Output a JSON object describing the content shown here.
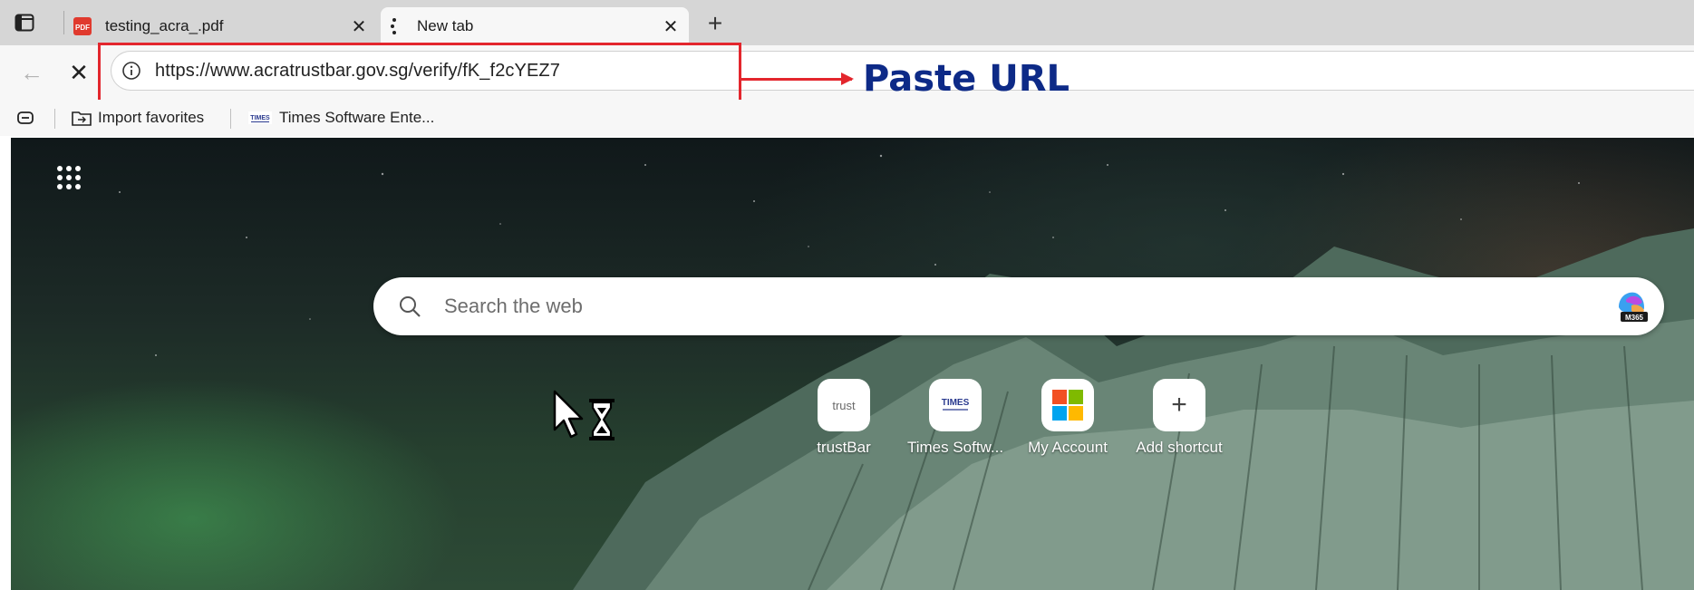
{
  "tabs": [
    {
      "title": "testing_acra_.pdf",
      "favicon": "pdf-icon",
      "active": false,
      "favicon_text": "PDF"
    },
    {
      "title": "New tab",
      "favicon": "loading-icon",
      "active": true
    }
  ],
  "address_bar": {
    "url": "https://www.acratrustbar.gov.sg/verify/fK_f2cYEZ7"
  },
  "annotation": {
    "label": "Paste URL",
    "color": "#e3262d",
    "label_color": "#0d2a87"
  },
  "bookmarks": [
    {
      "label": "Import favorites",
      "icon": "import-favorites-icon"
    },
    {
      "label": "Times Software Ente...",
      "icon": "times-software-icon",
      "icon_text": "TIMES"
    }
  ],
  "search": {
    "placeholder": "Search the web",
    "m365_badge": "M365"
  },
  "shortcuts": [
    {
      "label": "trustBar",
      "icon": "trustbar-icon",
      "tile_text": "trust"
    },
    {
      "label": "Times Softw...",
      "icon": "times-software-icon",
      "tile_text": "TIMES"
    },
    {
      "label": "My Account",
      "icon": "microsoft-logo-icon"
    },
    {
      "label": "Add shortcut",
      "icon": "plus-icon"
    }
  ]
}
